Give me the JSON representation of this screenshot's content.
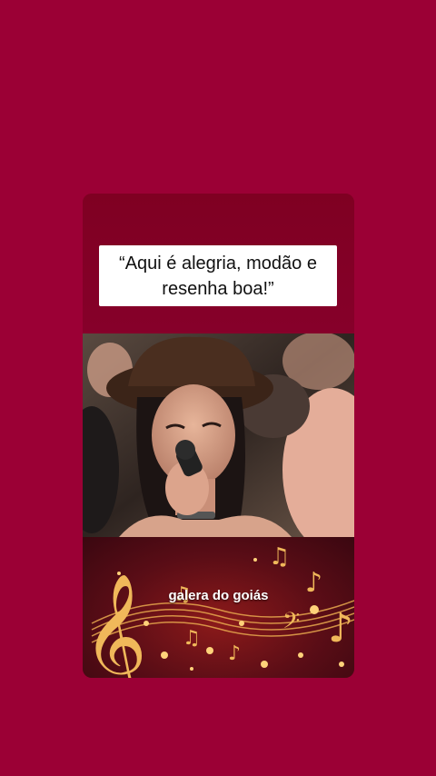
{
  "quote": {
    "text": "“Aqui é alegria, modão e resenha boa!”"
  },
  "caption": {
    "text": "galera do goiás"
  },
  "colors": {
    "background": "#9b0035",
    "card_top": "#7f0022",
    "quote_box": "#ffffff",
    "caption_text": "#ffffff",
    "music_gold": "#f0b85a"
  },
  "icons": {
    "photo": "singer-with-microphone-photo",
    "decoration": "golden-music-notes"
  }
}
